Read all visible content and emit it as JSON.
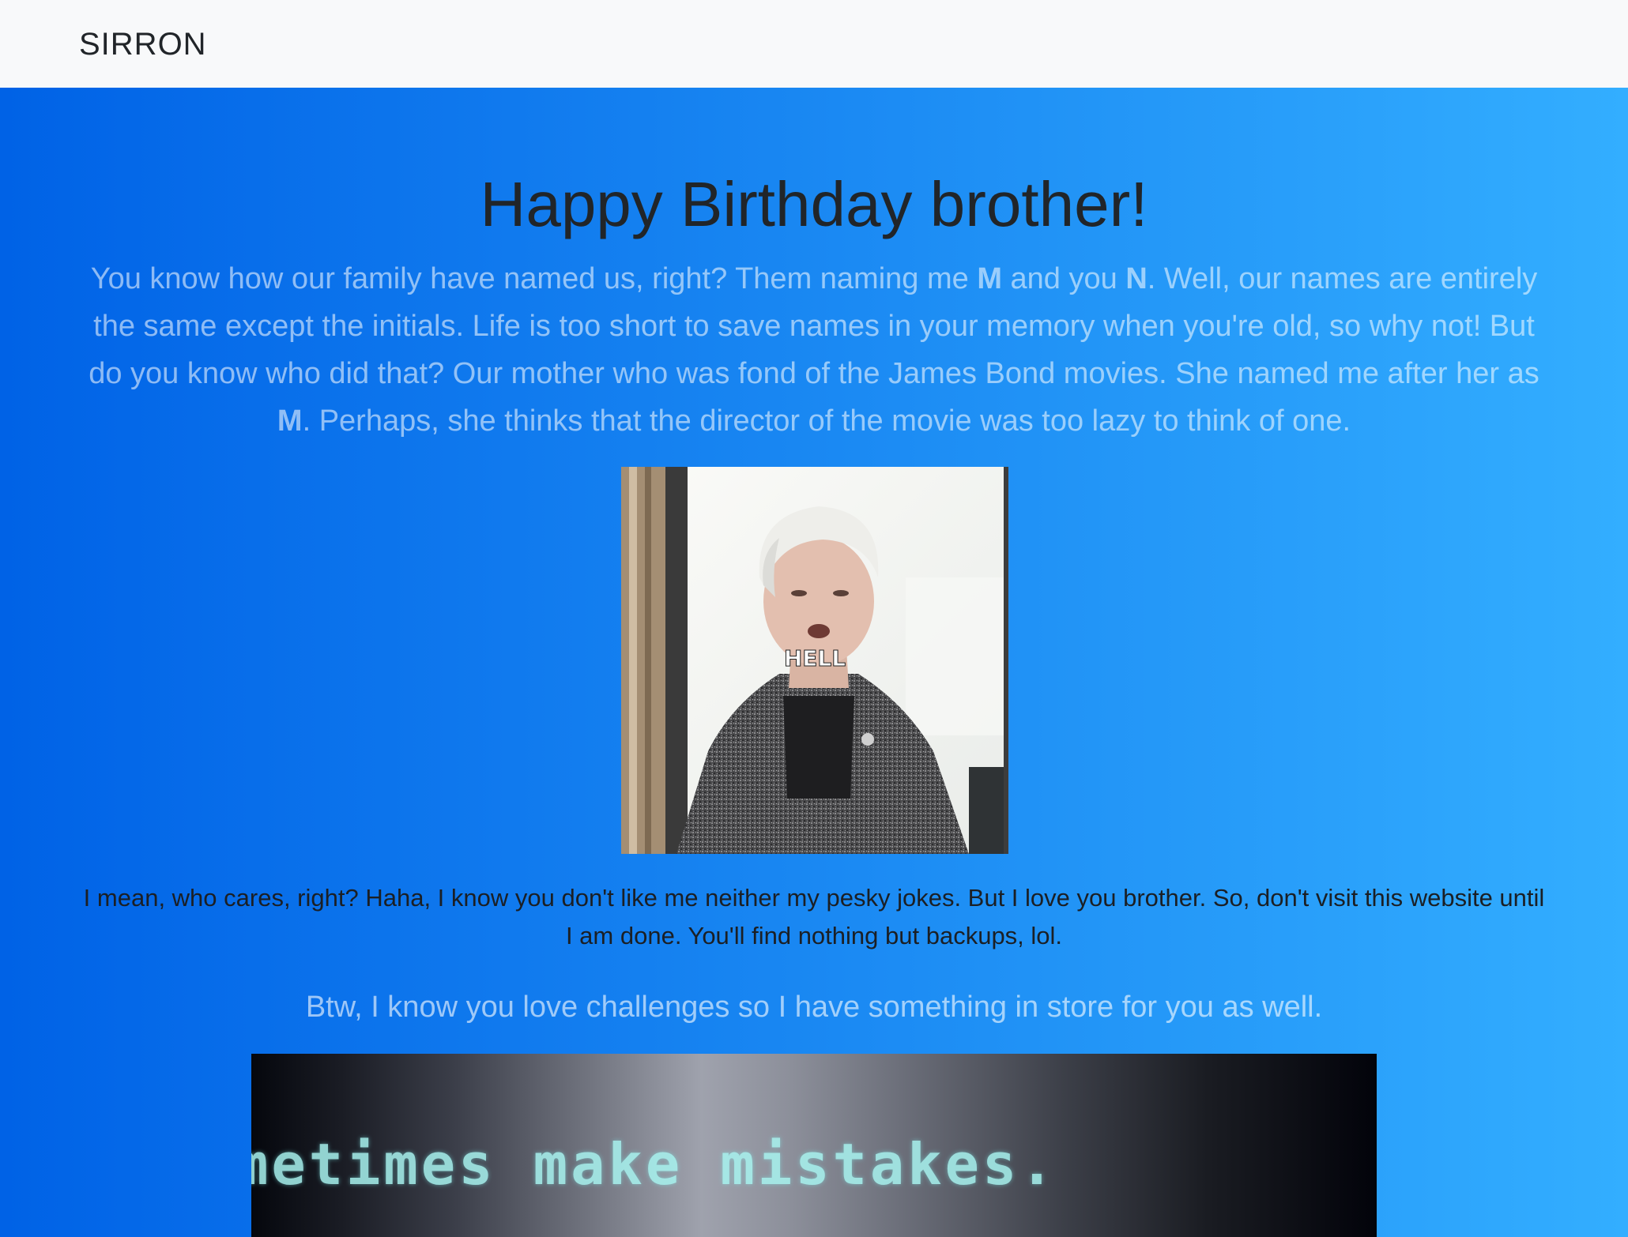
{
  "navbar": {
    "brand": "SIRRON"
  },
  "main": {
    "title": "Happy Birthday brother!",
    "lead": {
      "part1": "You know how our family have named us, right? Them naming me ",
      "m1": "M",
      "part2": " and you ",
      "n1": "N",
      "part3": ". Well, our names are entirely the same except the initials. Life is too short to save names in your memory when you're old, so why not! But do you know who did that? Our mother who was fond of the James Bond movies. She named me after her as ",
      "m2": "M",
      "part4": ". Perhaps, she thinks that the director of the movie was too lazy to think of one."
    },
    "gif_caption": "HELL",
    "body_text": "I mean, who cares, right? Haha, I know you don't like me neither my pesky jokes. But I love you brother. So, don't visit this website until I am done. You'll find nothing but backups, lol.",
    "btw_text": "Btw, I know you love challenges so I have something in store for you as well.",
    "video_text": "metimes make mistakes."
  },
  "colors": {
    "gradient_start": "#0062e6",
    "gradient_end": "#33aeff",
    "navbar_bg": "#f8f9fa"
  }
}
